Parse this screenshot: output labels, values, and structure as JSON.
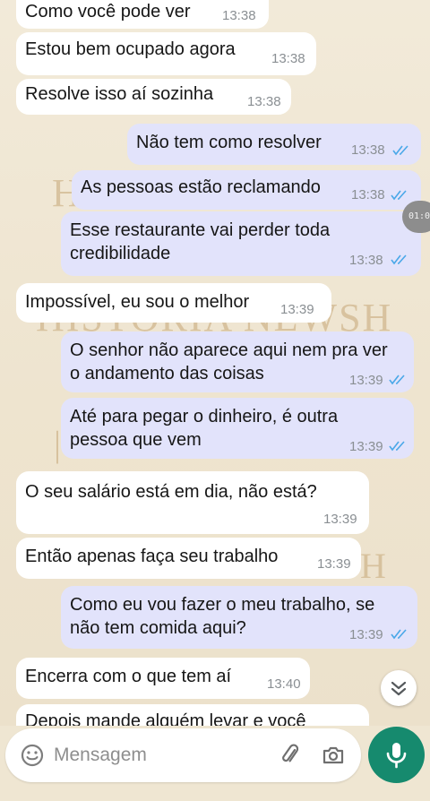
{
  "watermark": {
    "text": "HISTÓRIA NEWSH"
  },
  "messages": [
    {
      "text": "Como você pode ver",
      "time": "13:38"
    },
    {
      "text": "Estou bem ocupado agora",
      "time": "13:38"
    },
    {
      "text": "Resolve isso aí sozinha",
      "time": "13:38"
    },
    {
      "text": "Não tem como resolver",
      "time": "13:38"
    },
    {
      "text": "As pessoas estão reclamando",
      "time": "13:38"
    },
    {
      "line1": "Esse restaurante vai perder toda",
      "line2": "credibilidade",
      "time": "13:38"
    },
    {
      "text": "Impossível, eu sou o melhor",
      "time": "13:39"
    },
    {
      "line1": "O senhor não aparece aqui nem pra ver",
      "line2": "o andamento das coisas",
      "time": "13:39"
    },
    {
      "line1": "Até para pegar o dinheiro, é outra",
      "line2": "pessoa que vem",
      "time": "13:39"
    },
    {
      "text": "O seu salário está em dia, não está?",
      "time": "13:39"
    },
    {
      "text": "Então apenas faça seu trabalho",
      "time": "13:39"
    },
    {
      "line1": "Como eu vou fazer o meu trabalho, se",
      "line2": "não tem comida aqui?",
      "time": "13:39"
    },
    {
      "text": "Encerra com o que tem aí",
      "time": "13:40"
    },
    {
      "text": "Depois mande alguém levar e você"
    }
  ],
  "video_timestamp": "01:02",
  "composer": {
    "placeholder": "Mensagem"
  },
  "colors": {
    "incoming": "#ffffff",
    "outgoing": "#e2e3fb",
    "read_ticks": "#4aa8e8",
    "mic": "#168a6e"
  }
}
